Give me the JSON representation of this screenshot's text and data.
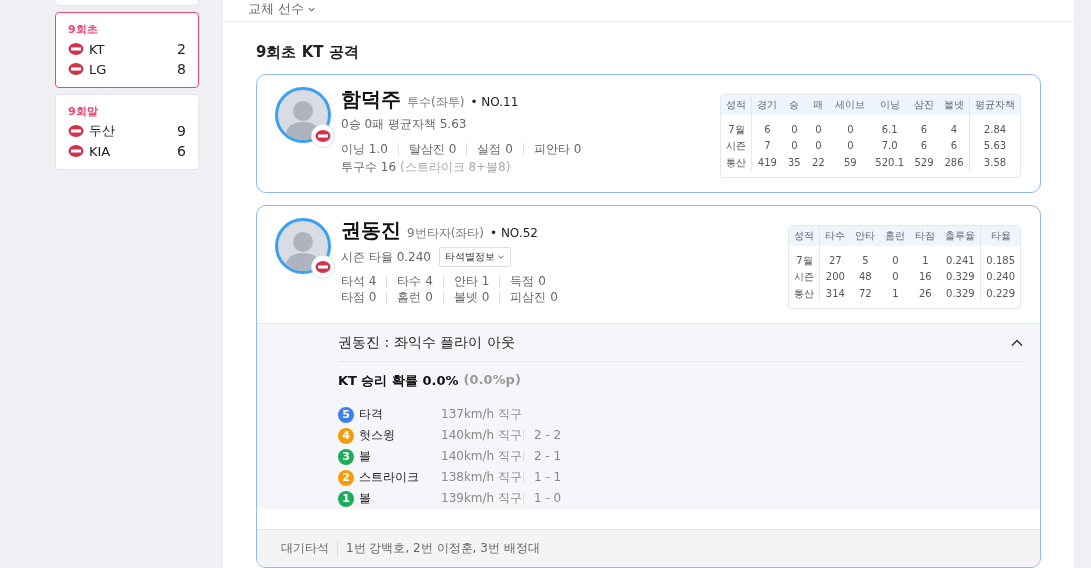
{
  "sidebar": {
    "games": [
      {
        "inning": "9회초",
        "selected": true,
        "teams": [
          {
            "name": "KT",
            "score": "2"
          },
          {
            "name": "LG",
            "score": "8"
          }
        ]
      },
      {
        "inning": "9회말",
        "selected": false,
        "teams": [
          {
            "name": "두산",
            "score": "9"
          },
          {
            "name": "KIA",
            "score": "6"
          }
        ]
      }
    ]
  },
  "filter": {
    "label": "교체 선수"
  },
  "section_title": "9회초 KT 공격",
  "pitcher": {
    "name": "함덕주",
    "role": "투수(좌투)",
    "number": "• NO.11",
    "record": "0승 0패 평균자책 5.63",
    "stat_lines": [
      [
        {
          "label": "이닝",
          "value": "1.0"
        },
        {
          "label": "탈삼진",
          "value": "0"
        },
        {
          "label": "실점",
          "value": "0"
        },
        {
          "label": "피안타",
          "value": "0"
        }
      ]
    ],
    "pitch_count": {
      "label": "투구수",
      "value": "16",
      "detail": "(스트라이크 8+볼8)"
    },
    "table": {
      "columns": [
        "성적",
        "경기",
        "승",
        "패",
        "세이브",
        "이닝",
        "삼진",
        "볼넷",
        "평균자책"
      ],
      "rows": [
        [
          "7월",
          "6",
          "0",
          "0",
          "0",
          "6.1",
          "6",
          "4",
          "2.84"
        ],
        [
          "시즌",
          "7",
          "0",
          "0",
          "0",
          "7.0",
          "6",
          "6",
          "5.63"
        ],
        [
          "통산",
          "419",
          "35",
          "22",
          "59",
          "520.1",
          "529",
          "286",
          "3.58"
        ]
      ]
    }
  },
  "batter": {
    "name": "권동진",
    "role": "9번타자(좌타)",
    "number": "• NO.52",
    "season_avg": "시즌 타율 0.240",
    "info_button": "타석별정보",
    "stat_lines": [
      [
        {
          "label": "타석",
          "value": "4"
        },
        {
          "label": "타수",
          "value": "4"
        },
        {
          "label": "안타",
          "value": "1"
        },
        {
          "label": "득점",
          "value": "0"
        }
      ],
      [
        {
          "label": "타점",
          "value": "0"
        },
        {
          "label": "홈런",
          "value": "0"
        },
        {
          "label": "볼넷",
          "value": "0"
        },
        {
          "label": "피삼진",
          "value": "0"
        }
      ]
    ],
    "table": {
      "columns": [
        "성적",
        "타수",
        "안타",
        "홈런",
        "타점",
        "출루율",
        "타율"
      ],
      "rows": [
        [
          "7월",
          "27",
          "5",
          "0",
          "1",
          "0.241",
          "0.185"
        ],
        [
          "시즌",
          "200",
          "48",
          "0",
          "16",
          "0.329",
          "0.240"
        ],
        [
          "통산",
          "314",
          "72",
          "1",
          "26",
          "0.329",
          "0.229"
        ]
      ]
    },
    "play": {
      "title": "권동진 : 좌익수 플라이 아웃",
      "expanded": true,
      "win_prob": "KT 승리 확률 0.0%",
      "win_prob_change": "(0.0%p)",
      "pitches": [
        {
          "number": "5",
          "color": "#3d7ff0",
          "result": "타격",
          "speed": "137km/h 직구"
        },
        {
          "number": "4",
          "color": "#f59c0b",
          "result": "헛스윙",
          "speed": "140km/h 직구",
          "count": "2 - 2"
        },
        {
          "number": "3",
          "color": "#1fad5a",
          "result": "볼",
          "speed": "140km/h 직구",
          "count": "2 - 1"
        },
        {
          "number": "2",
          "color": "#f59c0b",
          "result": "스트라이크",
          "speed": "138km/h 직구",
          "count": "1 - 1"
        },
        {
          "number": "1",
          "color": "#1fad5a",
          "result": "볼",
          "speed": "139km/h 직구",
          "count": "1 - 0"
        }
      ]
    }
  },
  "waiting": {
    "label": "대기타석",
    "text": "1번 강백호, 2번 이정훈, 3번 배정대"
  }
}
